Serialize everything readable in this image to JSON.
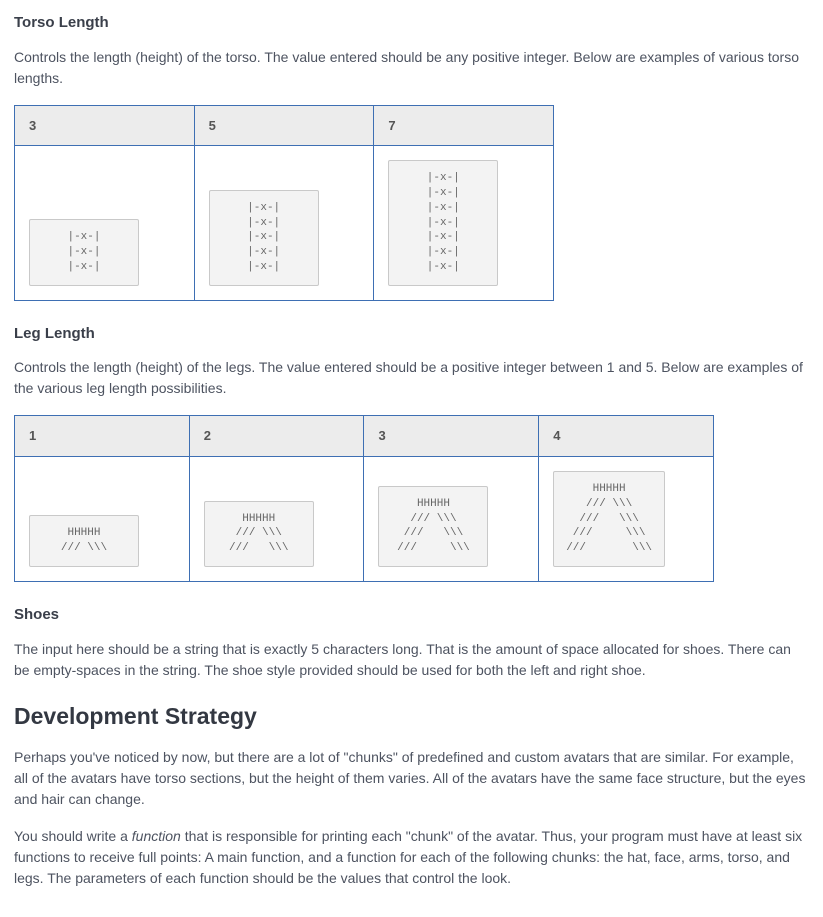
{
  "torso": {
    "heading": "Torso Length",
    "desc": "Controls the length (height) of the torso. The value entered should be any positive integer. Below are examples of various torso lengths.",
    "columns": [
      "3",
      "5",
      "7"
    ],
    "cells": [
      "|-x-|\n|-x-|\n|-x-|",
      "|-x-|\n|-x-|\n|-x-|\n|-x-|\n|-x-|",
      "|-x-|\n|-x-|\n|-x-|\n|-x-|\n|-x-|\n|-x-|\n|-x-|"
    ]
  },
  "legs": {
    "heading": "Leg Length",
    "desc": "Controls the length (height) of the legs. The value entered should be a positive integer between 1 and 5. Below are examples of the various leg length possibilities.",
    "columns": [
      "1",
      "2",
      "3",
      "4"
    ],
    "cells": [
      "HHHHH\n/// \\\\\\",
      " HHHHH \n/// \\\\\\\n///   \\\\\\",
      "  HHHHH  \n /// \\\\\\ \n ///   \\\\\\ \n///     \\\\\\",
      "   HHHHH   \n  /// \\\\\\  \n  ///   \\\\\\  \n ///     \\\\\\ \n///       \\\\\\"
    ]
  },
  "shoes": {
    "heading": "Shoes",
    "desc": "The input here should be a string that is exactly 5 characters long. That is the amount of space allocated for shoes. There can be empty-spaces in the string. The shoe style provided should be used for both the left and right shoe."
  },
  "strategy": {
    "heading": "Development Strategy",
    "p1": "Perhaps you've noticed by now, but there are a lot of \"chunks\" of predefined and custom avatars that are similar. For example, all of the avatars have torso sections, but the height of them varies. All of the avatars have the same face structure, but the eyes and hair can change.",
    "p2a": "You should write a ",
    "p2b": "function",
    "p2c": " that is responsible for printing each \"chunk\" of the avatar. Thus, your program must have at least six functions to receive full points: A main function, and a function for each of the following chunks: the hat, face, arms, torso, and legs. The parameters of each function should be the values that control the look."
  }
}
